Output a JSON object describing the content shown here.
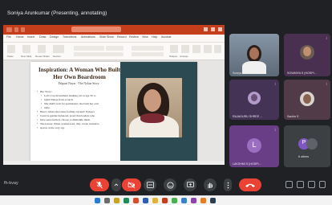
{
  "meeting": {
    "presenter_label": "Soniya Arunkumar (Presenting, annotating)",
    "meeting_code": "fh-kvay"
  },
  "ppt": {
    "tabs": [
      "File",
      "Home",
      "Insert",
      "Draw",
      "Design",
      "Transitions",
      "Animations",
      "Slide Show",
      "Record",
      "Review",
      "View",
      "Help",
      "Acrobat"
    ],
    "ribbon_labels": [
      "Paste",
      "New Slide",
      "Reuse Slides",
      "Section",
      "Shapes",
      "Arrange",
      "Quick Styles",
      "Dictate",
      "Designer"
    ],
    "slide": {
      "heading": "Inspiration: A Woman Who Built Her Own Boardroom",
      "subtitle": "Falguni Nayar - The Nykaa Story",
      "bullets": [
        {
          "text": "Her Story:",
          "level": 0
        },
        {
          "text": "Left a top investment banking job at age 50 to",
          "level": 1
        },
        {
          "text": "build Nykaa from scratch.",
          "level": 1
        },
        {
          "text": "She didn't wait for permission; she built her own",
          "level": 1
        },
        {
          "text": "table.",
          "level": 1
        },
        {
          "text": "Here's where the Glass Ceiling cracked: Nykaa's",
          "level": 0
        },
        {
          "text": "board is gender-balanced, proof that leaders who",
          "level": 0
        },
        {
          "text": "have seen barriers choose to dismantle them.",
          "level": 0
        },
        {
          "text": "The lesson: When women lead, they create inclusive",
          "level": 0
        },
        {
          "text": "spaces at the very top.",
          "level": 0
        }
      ]
    }
  },
  "participants": [
    {
      "name": "Soniya Arunkumar",
      "kind": "video",
      "bg": "#5a6b7d"
    },
    {
      "name": "SOWMIYA S (HOSPI...",
      "kind": "video",
      "bg": "#4a3050"
    },
    {
      "name": "RAJAGURU SHREE ...",
      "kind": "video",
      "bg": "#453356"
    },
    {
      "name": "Sachin S",
      "kind": "video",
      "bg": "#523b48"
    },
    {
      "name": "LAKSHMI S (HOSPI...",
      "kind": "avatar",
      "initial": "L",
      "bg": "#6a3e86",
      "avatar_color": "#9a6ec0"
    },
    {
      "name": "6 others",
      "kind": "others",
      "initial": "P",
      "bg": "#3c4043",
      "avatar_color": "#7e57c2"
    }
  ],
  "controls": [
    "mic-off",
    "more",
    "camera-off",
    "captions",
    "emoji",
    "present",
    "raise-hand",
    "more-options",
    "leave-call"
  ],
  "colors": {
    "meet_bg": "#202124",
    "ppt_accent": "#c43e1c",
    "danger": "#ea4335",
    "control_bg": "#3c4043"
  }
}
